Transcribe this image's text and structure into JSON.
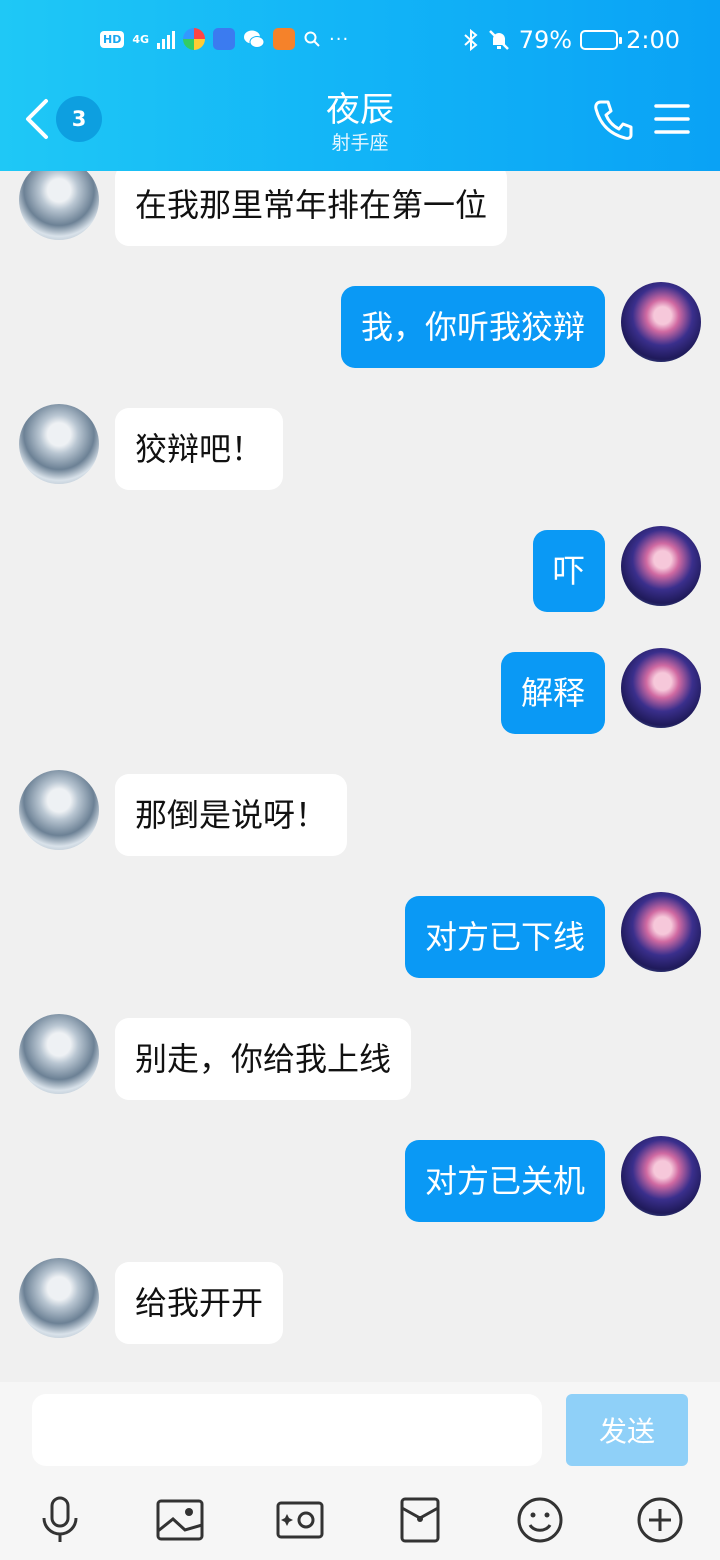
{
  "status_bar": {
    "left_labels": [
      "HD",
      "4G"
    ],
    "battery": "79%",
    "battery_level": 0.79,
    "time": "2:00"
  },
  "header": {
    "unread_count": "3",
    "title": "夜辰",
    "subtitle": "射手座"
  },
  "messages": [
    {
      "from": "other",
      "text": "在我那里常年排在第一位"
    },
    {
      "from": "self",
      "text": "我，你听我狡辩"
    },
    {
      "from": "other",
      "text": "狡辩吧！"
    },
    {
      "from": "self",
      "text": "吓"
    },
    {
      "from": "self",
      "text": "解释"
    },
    {
      "from": "other",
      "text": "那倒是说呀！"
    },
    {
      "from": "self",
      "text": "对方已下线"
    },
    {
      "from": "other",
      "text": "别走，你给我上线"
    },
    {
      "from": "self",
      "text": "对方已关机"
    },
    {
      "from": "other",
      "text": "给我开开"
    }
  ],
  "composer": {
    "send_label": "发送",
    "tools": [
      "microphone-icon",
      "image-icon",
      "camera-icon",
      "red-packet-icon",
      "emoji-icon",
      "plus-icon"
    ]
  },
  "colors": {
    "header_start": "#1fc8f6",
    "header_end": "#0aa2f5",
    "self_bubble": "#0a99f5",
    "other_bubble": "#ffffff",
    "send_button": "#8fd0f8"
  }
}
